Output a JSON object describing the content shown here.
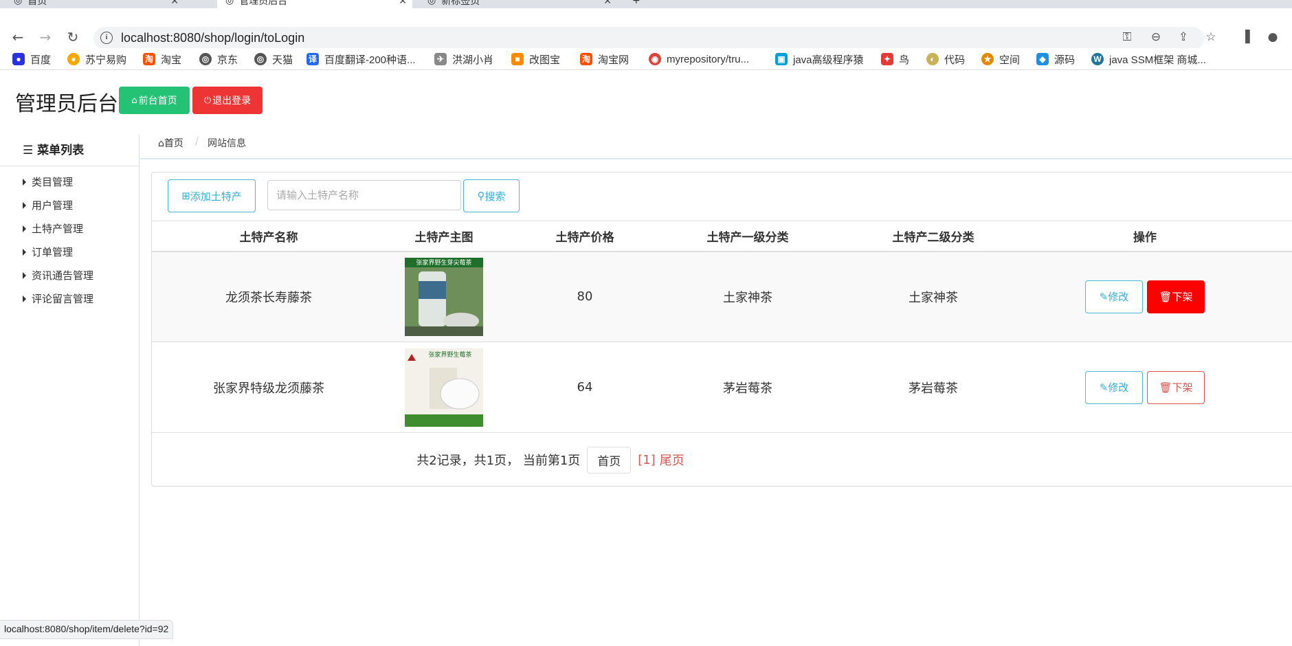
{
  "browser": {
    "tabs": [
      {
        "title": "首页"
      },
      {
        "title": "管理员后台"
      },
      {
        "title": "新标签页"
      }
    ],
    "url": "localhost:8080/shop/login/toLogin",
    "bookmarks": [
      {
        "label": "百度",
        "icon": "baidu-paw-icon",
        "color": "#2932e1"
      },
      {
        "label": "苏宁易购",
        "icon": "suning-lion-icon",
        "color": "#f7a800"
      },
      {
        "label": "淘宝",
        "icon": "taobao-icon",
        "color": "#ff5000"
      },
      {
        "label": "京东",
        "icon": "globe-icon",
        "color": "#555555"
      },
      {
        "label": "天猫",
        "icon": "globe-icon",
        "color": "#555555"
      },
      {
        "label": "百度翻译-200种语...",
        "icon": "translate-icon",
        "color": "#2468f2"
      },
      {
        "label": "洪湖小肖",
        "icon": "bird-icon",
        "color": "#888888"
      },
      {
        "label": "改图宝",
        "icon": "gaitubao-icon",
        "color": "#ff8a00"
      },
      {
        "label": "淘宝网",
        "icon": "taobao-icon",
        "color": "#ff5000"
      },
      {
        "label": "myrepository/tru...",
        "icon": "chrome-icon",
        "color": "#db4437"
      },
      {
        "label": "java高级程序猿",
        "icon": "bilibili-icon",
        "color": "#00a1d6"
      },
      {
        "label": "鸟",
        "icon": "bird-red-icon",
        "color": "#e53935"
      },
      {
        "label": "代码",
        "icon": "moon-icon",
        "color": "#c8b35a"
      },
      {
        "label": "空间",
        "icon": "qzone-icon",
        "color": "#e08a00"
      },
      {
        "label": "源码",
        "icon": "docker-icon",
        "color": "#1d91e0"
      },
      {
        "label": "java SSM框架 商城...",
        "icon": "wordpress-icon",
        "color": "#21759b"
      }
    ],
    "status_url": "localhost:8080/shop/item/delete?id=92"
  },
  "header": {
    "title": "管理员后台",
    "home_button": "前台首页",
    "logout_button": "退出登录"
  },
  "sidebar": {
    "title": "菜单列表",
    "items": [
      {
        "label": "类目管理"
      },
      {
        "label": "用户管理"
      },
      {
        "label": "土特产管理"
      },
      {
        "label": "订单管理"
      },
      {
        "label": "资讯通告管理"
      },
      {
        "label": "评论留言管理"
      }
    ]
  },
  "breadcrumb": {
    "home": "首页",
    "current": "网站信息"
  },
  "toolbar": {
    "add_button": "添加土特产",
    "search_placeholder": "请输入土特产名称",
    "search_button": "搜索"
  },
  "table": {
    "headers": [
      "土特产名称",
      "土特产主图",
      "土特产价格",
      "土特产一级分类",
      "土特产二级分类",
      "操作"
    ],
    "rows": [
      {
        "name": "龙须茶长寿藤茶",
        "price": "80",
        "cat1": "土家神茶",
        "cat2": "土家神茶",
        "image_text": "张家界野生芽尖莓茶",
        "edit": "修改",
        "off": "下架"
      },
      {
        "name": "张家界特级龙须藤茶",
        "price": "64",
        "cat1": "茅岩莓茶",
        "cat2": "茅岩莓茶",
        "image_text": "张家界野生莓茶",
        "edit": "修改",
        "off": "下架"
      }
    ]
  },
  "pagination": {
    "summary": "共2记录，共1页，  当前第1页",
    "first": "首页",
    "pages": "[1]",
    "last": "尾页"
  },
  "colors": {
    "success": "#23c275",
    "danger": "#ee3535",
    "info": "#31b0d5",
    "delete_active": "#ff0000"
  }
}
